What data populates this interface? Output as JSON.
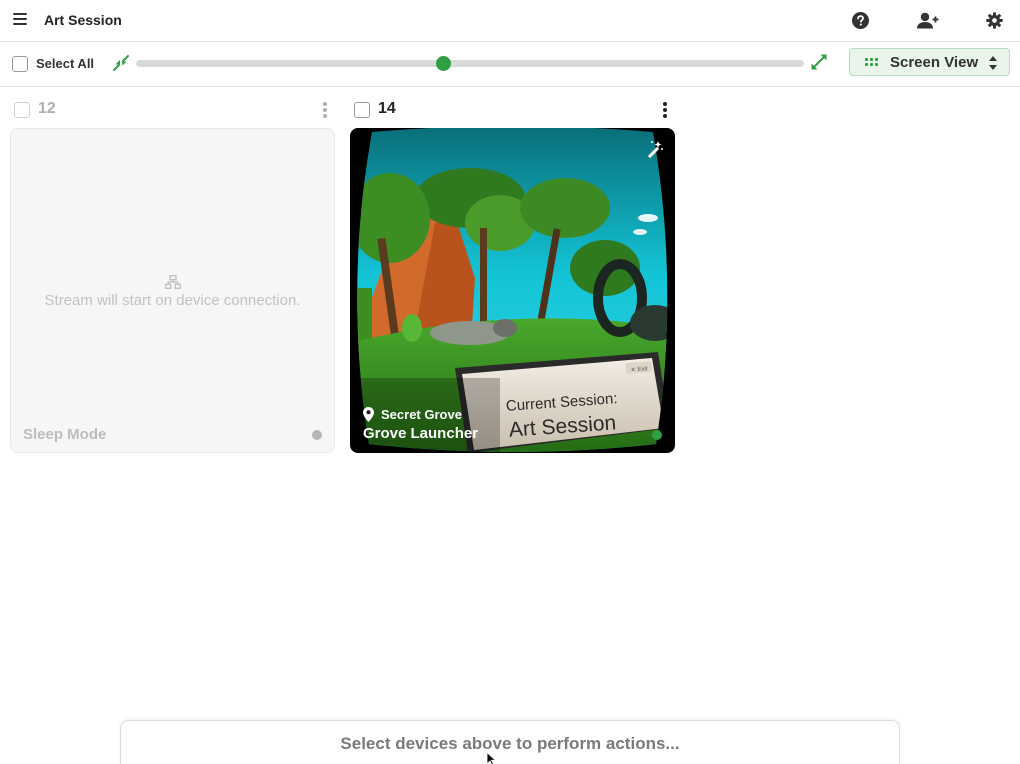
{
  "header": {
    "title": "Art Session",
    "icons": [
      "menu-icon",
      "help-icon",
      "add-user-icon",
      "settings-icon"
    ]
  },
  "toolbar": {
    "select_all_label": "Select All",
    "select_all_checked": false,
    "zoom_level": 0.46,
    "view_label": "Screen View",
    "accent_color": "#2ea043"
  },
  "devices": [
    {
      "number": "12",
      "checked": false,
      "status": "offline",
      "stream_message": "Stream will start on device connection.",
      "mode_label": "Sleep Mode",
      "status_color": "#b5b5b5"
    },
    {
      "number": "14",
      "checked": false,
      "status": "online",
      "location": "Secret Grove",
      "app_name": "Grove Launcher",
      "status_color": "#2ea043",
      "screen": {
        "sign_line1": "Current Session:",
        "sign_line2": "Art Session",
        "sign_tag": "✕ Exit"
      }
    }
  ],
  "action_bar": {
    "message": "Select devices above to perform actions..."
  }
}
